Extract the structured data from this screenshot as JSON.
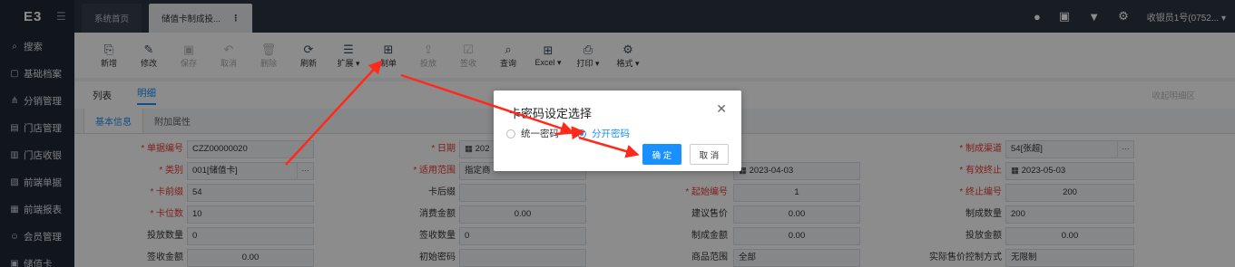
{
  "app": {
    "logo": "E3"
  },
  "sidebar": {
    "items": [
      {
        "icon": "search-icon",
        "glyph": "⌕",
        "label": "搜索"
      },
      {
        "icon": "archive-icon",
        "glyph": "▢",
        "label": "基础档案"
      },
      {
        "icon": "distribution-icon",
        "glyph": "⋔",
        "label": "分销管理"
      },
      {
        "icon": "store-icon",
        "glyph": "▤",
        "label": "门店管理"
      },
      {
        "icon": "cashier-icon",
        "glyph": "▥",
        "label": "门店收银"
      },
      {
        "icon": "document-icon",
        "glyph": "▧",
        "label": "前端单据"
      },
      {
        "icon": "report-icon",
        "glyph": "▦",
        "label": "前端报表"
      },
      {
        "icon": "member-icon",
        "glyph": "☺",
        "label": "会员管理"
      },
      {
        "icon": "card-icon",
        "glyph": "▣",
        "label": "储值卡"
      }
    ]
  },
  "tabs": [
    {
      "label": "系统首页"
    },
    {
      "label": "储值卡制成投..."
    }
  ],
  "tab_more": "⋮",
  "header": {
    "user": "收银员1号(0752... ▾"
  },
  "toolbar": [
    {
      "icon": "new-icon",
      "glyph": "⎘",
      "label": "新增",
      "enabled": true
    },
    {
      "icon": "edit-icon",
      "glyph": "✎",
      "label": "修改",
      "enabled": true
    },
    {
      "icon": "save-icon",
      "glyph": "▣",
      "label": "保存",
      "enabled": false
    },
    {
      "icon": "cancel-icon",
      "glyph": "↶",
      "label": "取消",
      "enabled": false
    },
    {
      "icon": "delete-icon",
      "glyph": "🗑",
      "label": "删除",
      "enabled": false
    },
    {
      "icon": "refresh-icon",
      "glyph": "⟳",
      "label": "刷新",
      "enabled": true
    },
    {
      "icon": "extend-icon",
      "glyph": "☰",
      "label": "扩展 ▾",
      "enabled": true
    },
    {
      "icon": "make-icon",
      "glyph": "⊞",
      "label": "制单",
      "enabled": true
    },
    {
      "icon": "issue-icon",
      "glyph": "⇪",
      "label": "投放",
      "enabled": false
    },
    {
      "icon": "sign-icon",
      "glyph": "☑",
      "label": "签收",
      "enabled": false
    },
    {
      "icon": "query-icon",
      "glyph": "⌕",
      "label": "查询",
      "enabled": true
    },
    {
      "icon": "excel-icon",
      "glyph": "⊞",
      "label": "Excel ▾",
      "enabled": true
    },
    {
      "icon": "print-icon",
      "glyph": "⎙",
      "label": "打印 ▾",
      "enabled": true
    },
    {
      "icon": "format-icon",
      "glyph": "⚙",
      "label": "格式 ▾",
      "enabled": true
    }
  ],
  "subtabs": {
    "list": "列表",
    "detail": "明细",
    "right": "收起明细区"
  },
  "infotabs": {
    "basic": "基本信息",
    "extra": "附加属性"
  },
  "form": {
    "doc_no_label": "* 单据编号",
    "doc_no": "CZZ00000020",
    "date_label": "* 日期",
    "date": "202",
    "channel_label": "* 制成渠道",
    "channel": "54[张超]",
    "type_label": "* 类别",
    "type": "001[储值卡]",
    "scope_label": "* 适用范围",
    "scope": "指定商",
    "start_date": "2023-04-03",
    "valid_end_label": "* 有效终止",
    "valid_end": "2023-05-03",
    "prefix_label": "* 卡前缀",
    "prefix": "54",
    "suffix_label": "卡后缀",
    "suffix": "",
    "start_no_label": "* 起始编号",
    "start_no": "1",
    "end_no_label": "* 终止编号",
    "end_no": "200",
    "digits_label": "* 卡位数",
    "digits": "10",
    "spend_label": "消费金额",
    "spend": "0.00",
    "suggest_price_label": "建议售价",
    "suggest_price": "0.00",
    "made_qty_label": "制成数量",
    "made_qty": "200",
    "issue_qty_label": "投放数量",
    "issue_qty": "0",
    "sign_qty_label": "签收数量",
    "sign_qty": "0",
    "made_amount_label": "制成金额",
    "made_amount": "0.00",
    "issue_amount_label": "投放金额",
    "issue_amount": "0.00",
    "sign_amount_label": "签收金额",
    "sign_amount": "0.00",
    "init_pwd_label": "初始密码",
    "goods_scope_label": "商品范围",
    "goods_scope": "全部",
    "price_ctrl_label": "实际售价控制方式",
    "price_ctrl": "无限制"
  },
  "dialog": {
    "title": "卡密码设定选择",
    "option_unified": "统一密码",
    "option_separate": "分开密码",
    "selected": "分开密码",
    "ok": "确 定",
    "cancel": "取 消"
  },
  "colors": {
    "accent": "#1890ff",
    "arrow": "#ff2a1a",
    "required": "#e53935"
  }
}
